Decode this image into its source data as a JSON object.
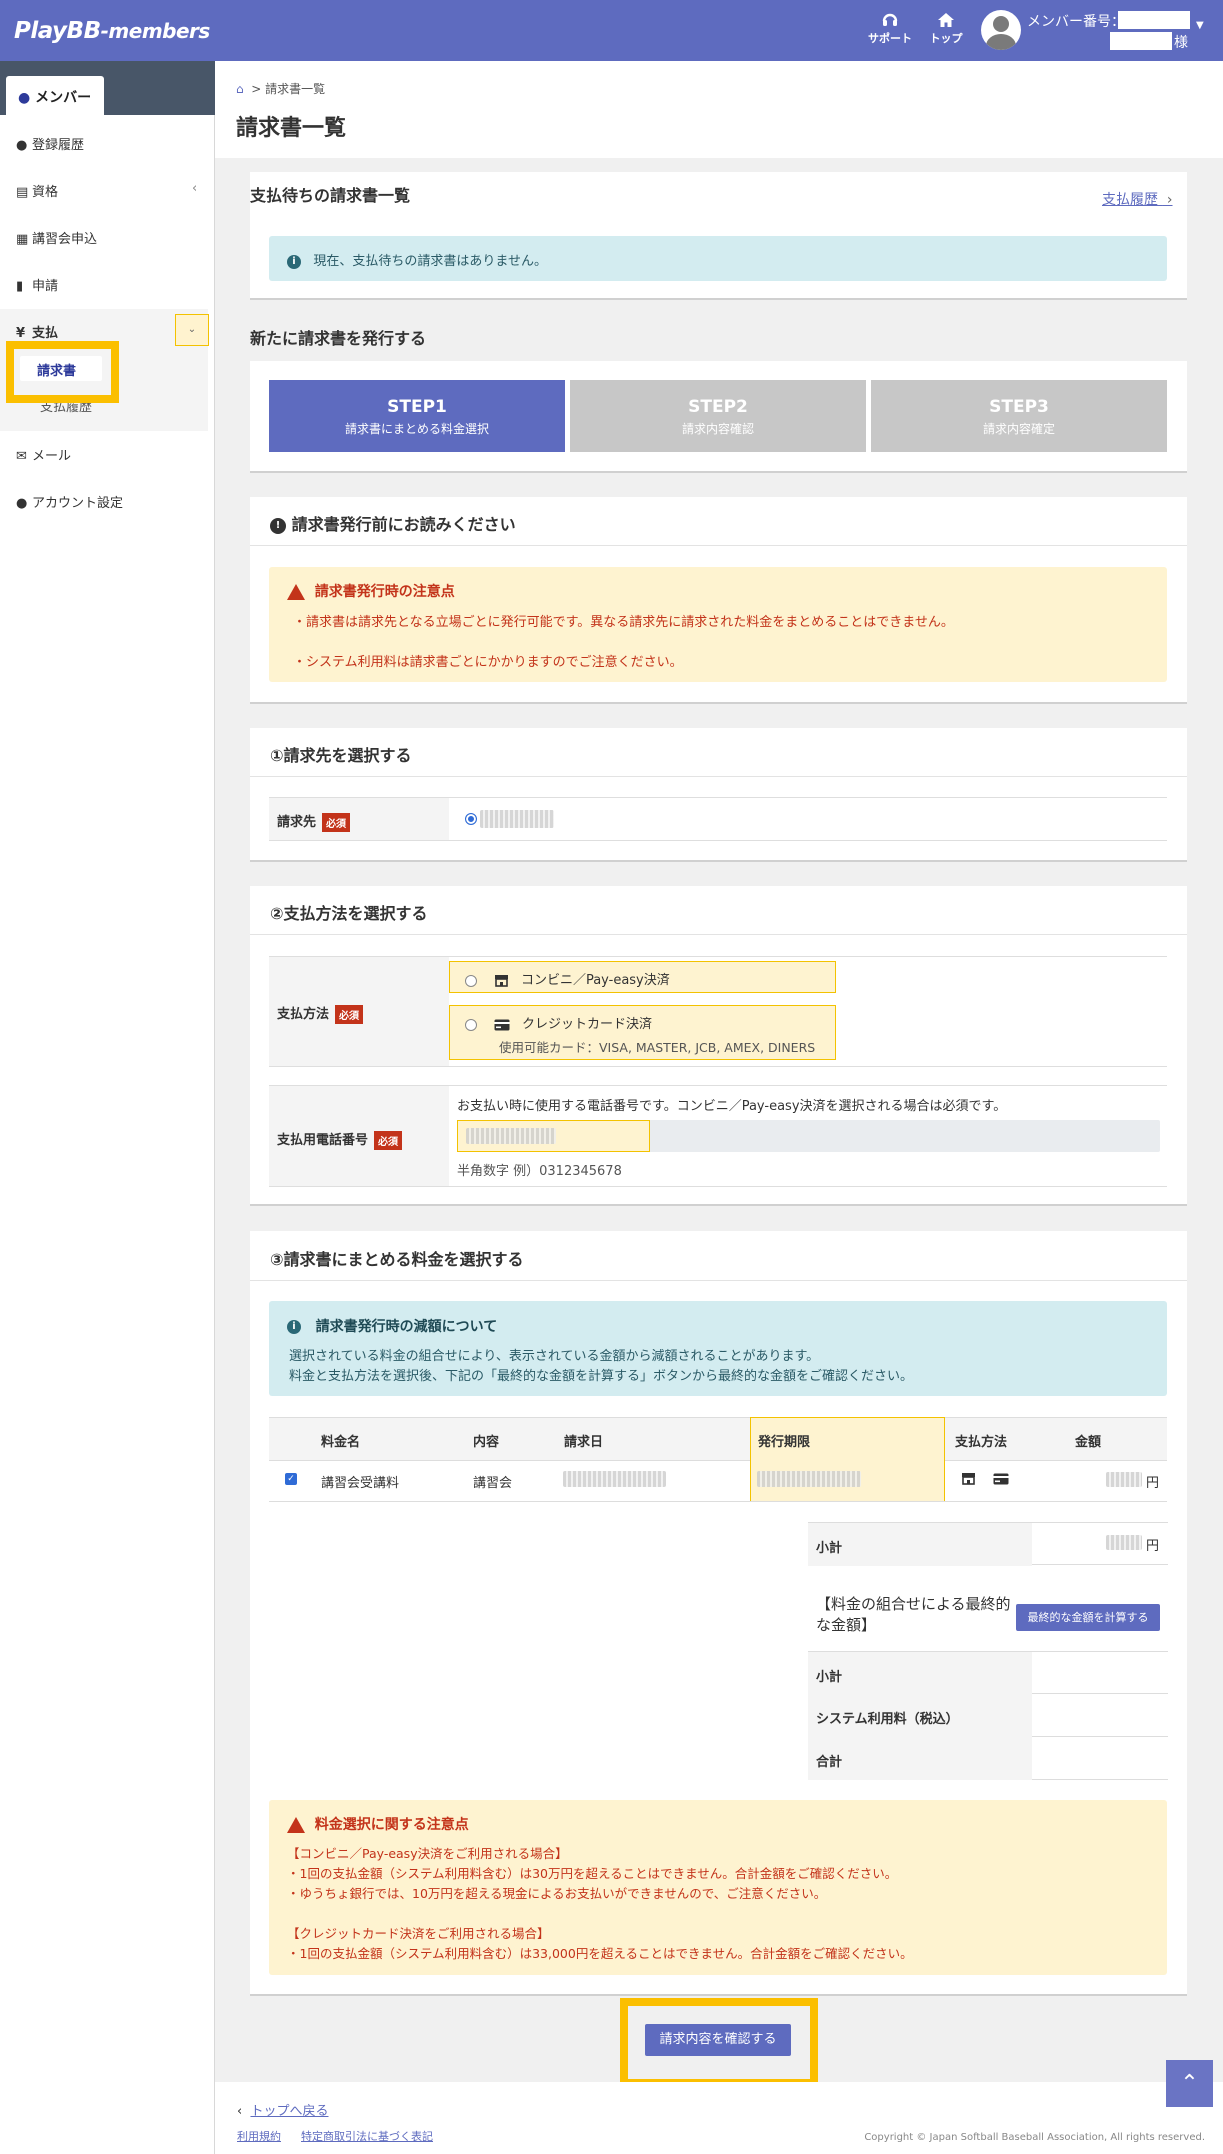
{
  "header": {
    "logo": "PlayBB",
    "logo_suffix": "-members",
    "support": "サポート",
    "top": "トップ",
    "member_label": "メンバー番号：",
    "sama": "様"
  },
  "sidebar": {
    "tab": "メンバー",
    "items": [
      {
        "label": "登録履歴"
      },
      {
        "label": "資格"
      },
      {
        "label": "講習会申込"
      },
      {
        "label": "申請"
      },
      {
        "label": "支払"
      },
      {
        "label": "請求書"
      },
      {
        "label": "支払履歴"
      },
      {
        "label": "メール"
      },
      {
        "label": "アカウント設定"
      }
    ]
  },
  "breadcrumb": "請求書一覧",
  "page_title": "請求書一覧",
  "pending": {
    "title": "支払待ちの請求書一覧",
    "history_link": "支払履歴",
    "empty_msg": "現在、支払待ちの請求書はありません。"
  },
  "new_invoice": {
    "title": "新たに請求書を発行する",
    "steps": [
      {
        "name": "STEP1",
        "desc": "請求書にまとめる料金選択"
      },
      {
        "name": "STEP2",
        "desc": "請求内容確認"
      },
      {
        "name": "STEP3",
        "desc": "請求内容確定"
      }
    ]
  },
  "notice": {
    "title": "請求書発行前にお読みください",
    "warn_title": "請求書発行時の注意点",
    "lines": [
      "・請求書は請求先となる立場ごとに発行可能です。異なる請求先に請求された料金をまとめることはできません。",
      "・システム利用料は請求書ごとにかかりますのでご注意ください。"
    ]
  },
  "section1": {
    "title": "①請求先を選択する",
    "label": "請求先",
    "required": "必須"
  },
  "section2": {
    "title": "②支払方法を選択する",
    "method_label": "支払方法",
    "required": "必須",
    "opt_conv": "コンビニ／Pay-easy決済",
    "opt_card": "クレジットカード決済",
    "card_note": "使用可能カード：VISA, MASTER, JCB, AMEX, DINERS",
    "phone_label": "支払用電話番号",
    "phone_note": "お支払い時に使用する電話番号です。コンビニ／Pay-easy決済を選択される場合は必須です。",
    "phone_hint": "半角数字 例）0312345678"
  },
  "section3": {
    "title": "③請求書にまとめる料金を選択する",
    "info_title": "請求書発行時の減額について",
    "info_lines": [
      "選択されている料金の組合せにより、表示されている金額から減額されることがあります。",
      "料金と支払方法を選択後、下記の「最終的な金額を計算する」ボタンから最終的な金額をご確認ください。"
    ],
    "columns": [
      "料金名",
      "内容",
      "請求日",
      "発行期限",
      "支払方法",
      "金額"
    ],
    "row": {
      "name": "講習会受講料",
      "content": "講習会",
      "yen": "円"
    },
    "subtotal": "小計",
    "subtotal_yen": "円",
    "final_label": "【料金の組合せによる最終的な金額】",
    "calc_btn": "最終的な金額を計算する",
    "final_rows": [
      "小計",
      "システム利用料（税込）",
      "合計"
    ],
    "warn_title": "料金選択に関する注意点",
    "warn_lines": [
      "【コンビニ／Pay-easy決済をご利用される場合】",
      "・1回の支払金額（システム利用料含む）は30万円を超えることはできません。合計金額をご確認ください。",
      "・ゆうちょ銀行では、10万円を超える現金によるお支払いができませんので、ご注意ください。",
      "",
      "【クレジットカード決済をご利用される場合】",
      "・1回の支払金額（システム利用料含む）は33,000円を超えることはできません。合計金額をご確認ください。"
    ]
  },
  "confirm_btn": "請求内容を確認する",
  "footer": {
    "back": "トップへ戻る",
    "terms": "利用規約",
    "law": "特定商取引法に基づく表記",
    "copyright": "Copyright © Japan Softball Baseball Association, All rights reserved."
  },
  "colors": {
    "primary": "#5e6bbf",
    "warn": "#c3331a",
    "highlight": "#fbbf00"
  }
}
